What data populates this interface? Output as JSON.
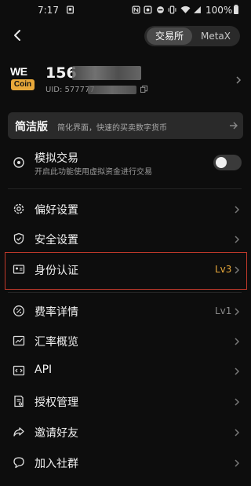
{
  "status": {
    "time": "7:17",
    "battery": "100%"
  },
  "header": {
    "back_icon": "chevron-left-icon",
    "segment": {
      "active": "交易所",
      "inactive": "MetaX"
    }
  },
  "profile": {
    "logo": {
      "top": "WE",
      "bottom": "Coin"
    },
    "username_visible": "156",
    "uid_visible": "UID: 577777"
  },
  "simple_mode": {
    "title": "简洁版",
    "subtitle": "简化界面，快速的买卖数字货币"
  },
  "demo_trading": {
    "label": "模拟交易",
    "sub": "开启此功能使用虚拟资金进行交易",
    "enabled": false
  },
  "menu": [
    {
      "label": "偏好设置",
      "icon": "gear-icon"
    },
    {
      "label": "安全设置",
      "icon": "shield-icon"
    },
    {
      "label": "身份认证",
      "icon": "id-card-icon",
      "badge": "Lv3",
      "badge_color": "#e8a83a"
    },
    {
      "label": "费率详情",
      "icon": "percent-icon",
      "badge": "Lv1",
      "badge_color": "#8a8a8a"
    },
    {
      "label": "汇率概览",
      "icon": "trend-chart-icon"
    },
    {
      "label": "API",
      "icon": "code-icon"
    },
    {
      "label": "授权管理",
      "icon": "authorization-doc-icon"
    },
    {
      "label": "邀请好友",
      "icon": "share-arrow-icon"
    },
    {
      "label": "加入社群",
      "icon": "chat-bubble-icon"
    }
  ]
}
